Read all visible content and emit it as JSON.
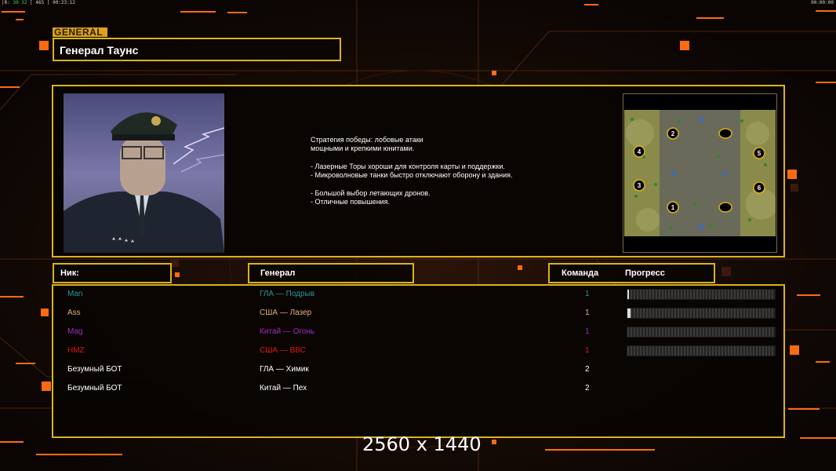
{
  "hud": {
    "left_prefix": "|R:",
    "left_value": "30 32",
    "left_extra": "[ 465 ]",
    "left_clock": "00:23:12",
    "right_clock": "00:00:00"
  },
  "general_tag": "GENERAL",
  "general_name": "Генерал Таунс",
  "description": [
    "Стратегия победы: лобовые атаки",
    "мощными и крепкими юнитами.",
    "",
    "- Лазерные Торы хороши для контроля карты и поддержки.",
    "- Микроволновые танки быстро отключают оборону и здания.",
    "",
    "- Большой выбор летающих дронов.",
    "- Отличные повышения."
  ],
  "minimap": {
    "start_positions": [
      "2",
      "4",
      "5",
      "3",
      "6",
      "1"
    ]
  },
  "headers": {
    "nick": "Ник:",
    "general": "Генерал",
    "team": "Команда",
    "progress": "Прогресс"
  },
  "players": [
    {
      "nick": "Man",
      "general": "ГЛА — Подрыв",
      "team": "1",
      "color": "#1f9a9a",
      "progress": 0.01
    },
    {
      "nick": "Ass",
      "general": "США — Лазер",
      "team": "1",
      "color": "#e0b07a",
      "progress": 0.02
    },
    {
      "nick": "Mag",
      "general": "Китай — Огонь",
      "team": "1",
      "color": "#9a30c8",
      "progress": 0.0
    },
    {
      "nick": "HMZ",
      "general": "США — ВВС",
      "team": "1",
      "color": "#e01818",
      "progress": 0.0
    },
    {
      "nick": "Безумный БОТ",
      "general": "ГЛА — Химик",
      "team": "2",
      "color": "#ffffff"
    },
    {
      "nick": "Безумный БОТ",
      "general": "Китай — Пех",
      "team": "2",
      "color": "#ffffff"
    }
  ],
  "resolution_label": "2560 x 1440",
  "colors": {
    "accent": "#dcb31a",
    "orange": "#ff6a10"
  }
}
